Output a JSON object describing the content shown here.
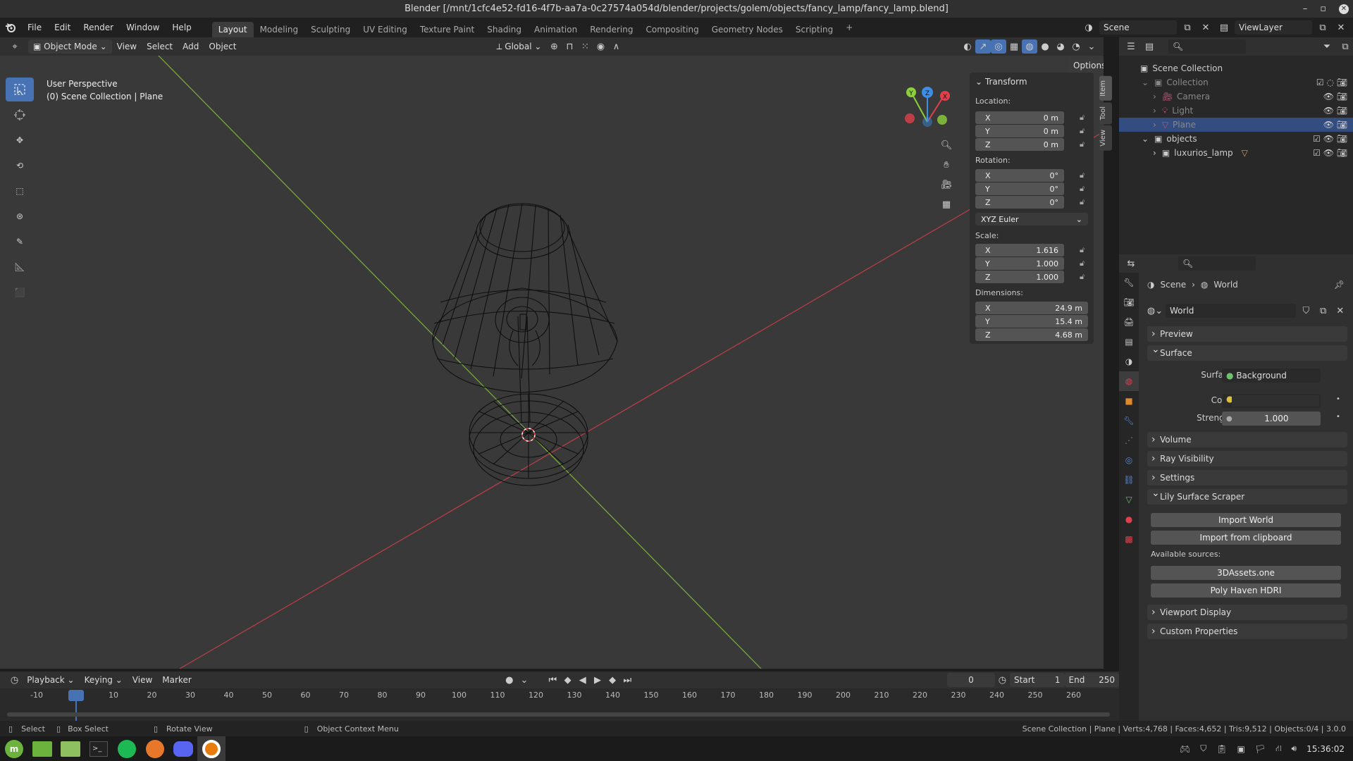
{
  "window": {
    "title": "Blender [/mnt/1cfc4e52-fd16-4f7b-aa7a-0c27574a054d/blender/projects/golem/objects/fancy_lamp/fancy_lamp.blend]"
  },
  "menus": [
    "File",
    "Edit",
    "Render",
    "Window",
    "Help"
  ],
  "workspaces": [
    "Layout",
    "Modeling",
    "Sculpting",
    "UV Editing",
    "Texture Paint",
    "Shading",
    "Animation",
    "Rendering",
    "Compositing",
    "Geometry Nodes",
    "Scripting"
  ],
  "active_workspace": "Layout",
  "scene_name": "Scene",
  "view_layer": "ViewLayer",
  "viewport_header": {
    "mode": "Object Mode",
    "view": "View",
    "select": "Select",
    "add": "Add",
    "object": "Object",
    "orientation": "Global",
    "options": "Options"
  },
  "viewport": {
    "perspective": "User Perspective",
    "collection_info": "(0) Scene Collection | Plane"
  },
  "n_panel": {
    "section": "Transform",
    "location_label": "Location:",
    "location": {
      "x": "0 m",
      "y": "0 m",
      "z": "0 m"
    },
    "rotation_label": "Rotation:",
    "rotation": {
      "x": "0°",
      "y": "0°",
      "z": "0°"
    },
    "rotation_mode": "XYZ Euler",
    "scale_label": "Scale:",
    "scale": {
      "x": "1.616",
      "y": "1.000",
      "z": "1.000"
    },
    "dimensions_label": "Dimensions:",
    "dimensions": {
      "x": "24.9 m",
      "y": "15.4 m",
      "z": "4.68 m"
    },
    "axis": {
      "x": "X",
      "y": "Y",
      "z": "Z"
    },
    "tabs": [
      "Item",
      "Tool",
      "View"
    ]
  },
  "outliner": {
    "root": "Scene Collection",
    "rows": [
      {
        "label": "Collection"
      },
      {
        "label": "Camera"
      },
      {
        "label": "Light"
      },
      {
        "label": "Plane"
      },
      {
        "label": "objects"
      },
      {
        "label": "luxurios_lamp"
      }
    ]
  },
  "properties": {
    "breadcrumb_scene": "Scene",
    "breadcrumb_world": "World",
    "world_name": "World",
    "sections": {
      "preview": "Preview",
      "surface": "Surface",
      "volume": "Volume",
      "ray_visibility": "Ray Visibility",
      "settings": "Settings",
      "lily": "Lily Surface Scraper",
      "viewport_display": "Viewport Display",
      "custom_properties": "Custom Properties"
    },
    "surface_label": "Surface",
    "surface_value": "Background",
    "color_label": "Color",
    "strength_label": "Strength",
    "strength_value": "1.000",
    "import_world": "Import World",
    "import_clipboard": "Import from clipboard",
    "available_sources": "Available sources:",
    "source1": "3DAssets.one",
    "source2": "Poly Haven HDRI"
  },
  "timeline": {
    "playback": "Playback",
    "keying": "Keying",
    "view": "View",
    "marker": "Marker",
    "current_frame": "0",
    "start_label": "Start",
    "start": "1",
    "end_label": "End",
    "end": "250",
    "ticks": [
      "-10",
      "0",
      "10",
      "20",
      "30",
      "40",
      "50",
      "60",
      "70",
      "80",
      "90",
      "100",
      "110",
      "120",
      "130",
      "140",
      "150",
      "160",
      "170",
      "180",
      "190",
      "200",
      "210",
      "220",
      "230",
      "240",
      "250",
      "260"
    ]
  },
  "statusbar": {
    "select": "Select",
    "box_select": "Box Select",
    "rotate_view": "Rotate View",
    "context_menu": "Object Context Menu",
    "stats": "Scene Collection | Plane | Verts:4,768 | Faces:4,652 | Tris:9,512 | Objects:0/4 | 3.0.0"
  },
  "taskbar": {
    "time": "15:36:02"
  },
  "colors": {
    "accent": "#4772b3",
    "x_axis": "#e0404a",
    "y_axis": "#8ccf3a",
    "z_axis": "#3c8ee6",
    "background": "#393939"
  }
}
